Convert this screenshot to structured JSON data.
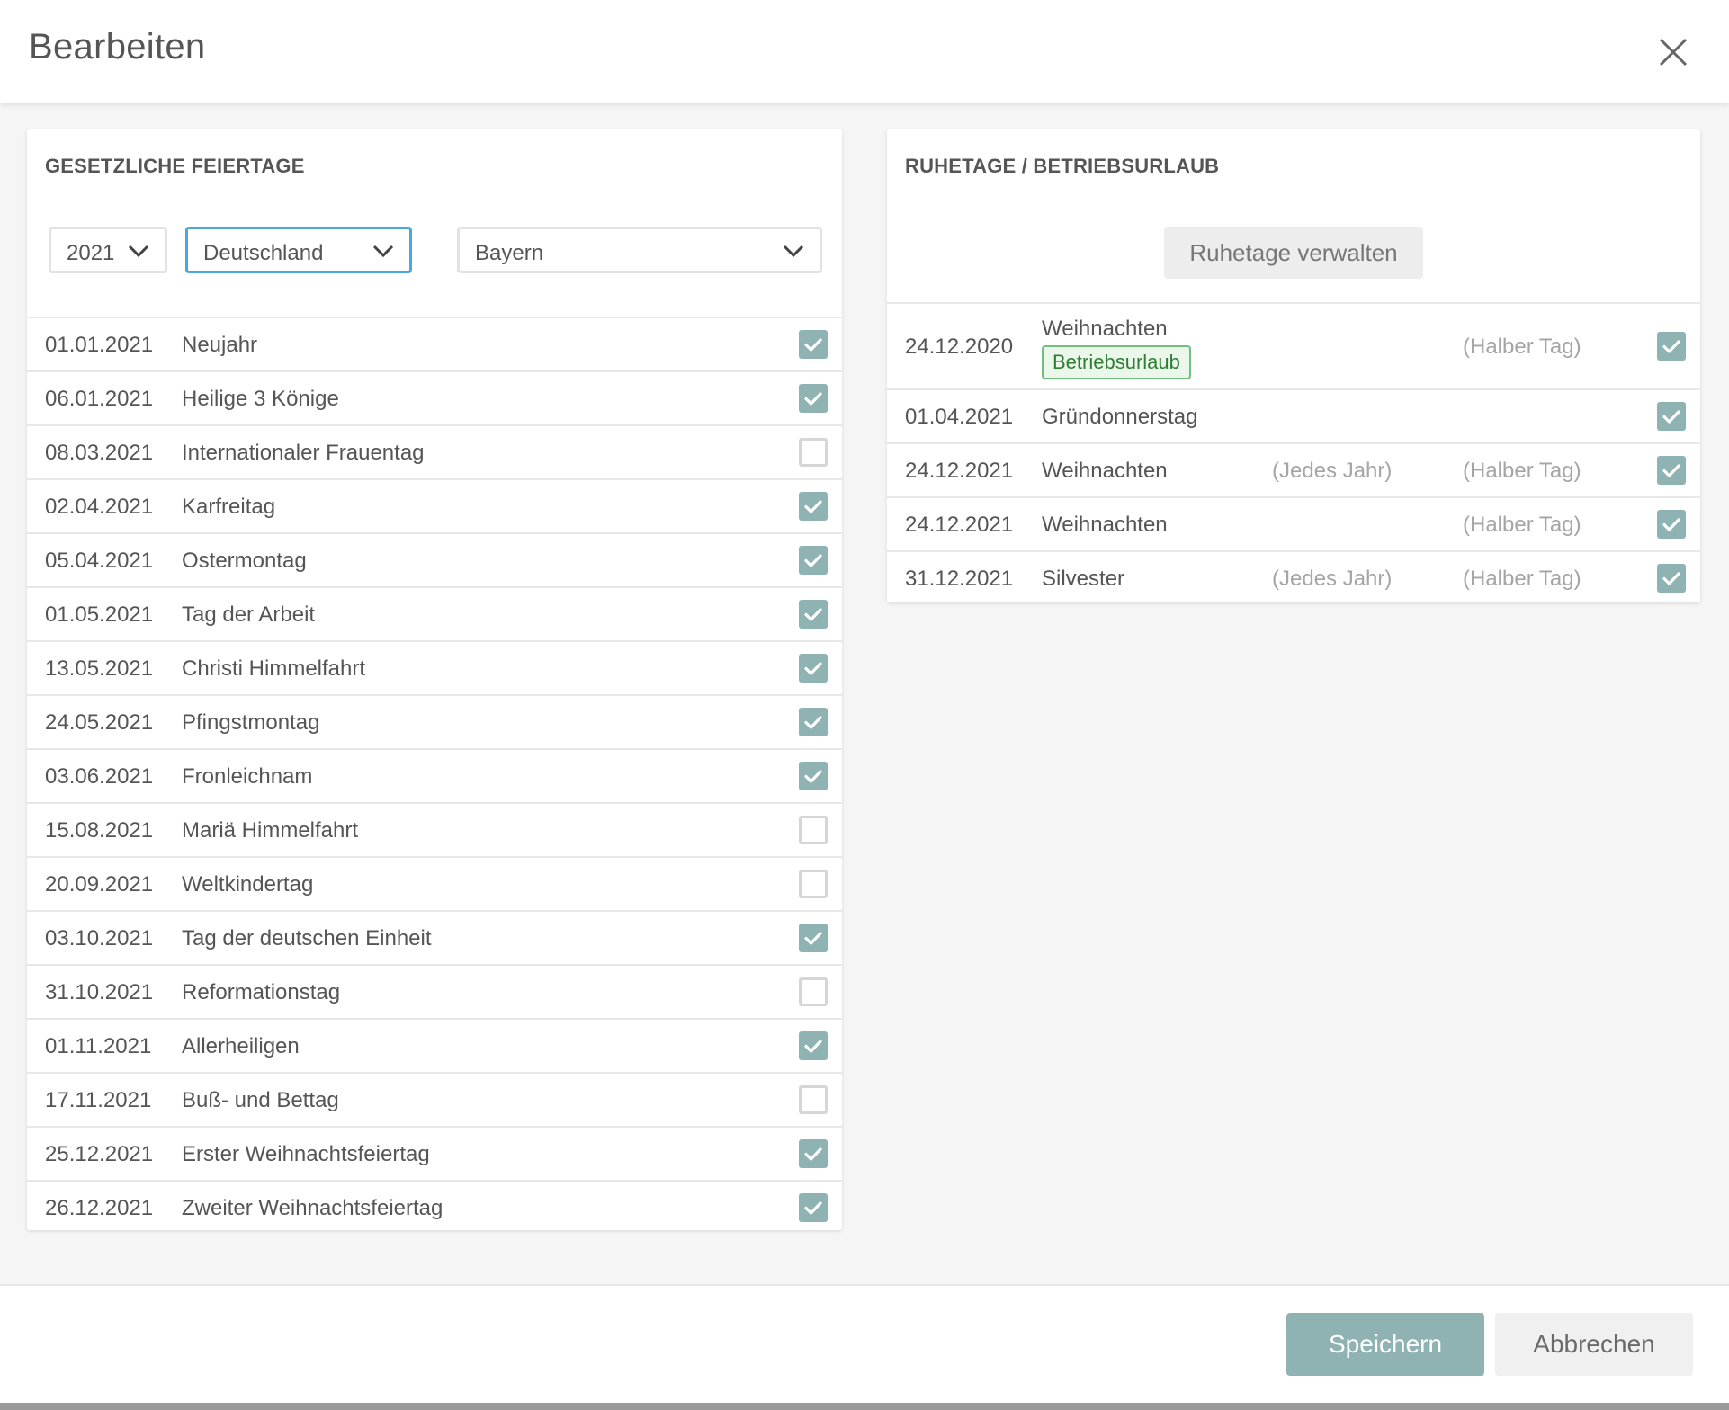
{
  "dialog": {
    "title": "Bearbeiten",
    "close_icon": "close-icon"
  },
  "left_card": {
    "title": "GESETZLICHE FEIERTAGE",
    "year_select": {
      "value": "2021"
    },
    "country_select": {
      "value": "Deutschland"
    },
    "state_select": {
      "value": "Bayern"
    },
    "holidays": [
      {
        "date": "01.01.2021",
        "name": "Neujahr",
        "checked": true
      },
      {
        "date": "06.01.2021",
        "name": "Heilige 3 Könige",
        "checked": true
      },
      {
        "date": "08.03.2021",
        "name": "Internationaler Frauentag",
        "checked": false
      },
      {
        "date": "02.04.2021",
        "name": "Karfreitag",
        "checked": true
      },
      {
        "date": "05.04.2021",
        "name": "Ostermontag",
        "checked": true
      },
      {
        "date": "01.05.2021",
        "name": "Tag der Arbeit",
        "checked": true
      },
      {
        "date": "13.05.2021",
        "name": "Christi Himmelfahrt",
        "checked": true
      },
      {
        "date": "24.05.2021",
        "name": "Pfingstmontag",
        "checked": true
      },
      {
        "date": "03.06.2021",
        "name": "Fronleichnam",
        "checked": true
      },
      {
        "date": "15.08.2021",
        "name": "Mariä Himmelfahrt",
        "checked": false
      },
      {
        "date": "20.09.2021",
        "name": "Weltkindertag",
        "checked": false
      },
      {
        "date": "03.10.2021",
        "name": "Tag der deutschen Einheit",
        "checked": true
      },
      {
        "date": "31.10.2021",
        "name": "Reformationstag",
        "checked": false
      },
      {
        "date": "01.11.2021",
        "name": "Allerheiligen",
        "checked": true
      },
      {
        "date": "17.11.2021",
        "name": "Buß- und Bettag",
        "checked": false
      },
      {
        "date": "25.12.2021",
        "name": "Erster Weihnachtsfeiertag",
        "checked": true
      },
      {
        "date": "26.12.2021",
        "name": "Zweiter Weihnachtsfeiertag",
        "checked": true
      }
    ]
  },
  "right_card": {
    "title": "RUHETAGE / BETRIEBSURLAUB",
    "manage_button": "Ruhetage verwalten",
    "rest_days": [
      {
        "date": "24.12.2020",
        "name": "Weihnachten",
        "badge": "Betriebsurlaub",
        "every_year": "",
        "half_day": "(Halber Tag)",
        "checked": true
      },
      {
        "date": "01.04.2021",
        "name": "Gründonnerstag",
        "badge": "",
        "every_year": "",
        "half_day": "",
        "checked": true
      },
      {
        "date": "24.12.2021",
        "name": "Weihnachten",
        "badge": "",
        "every_year": "(Jedes Jahr)",
        "half_day": "(Halber Tag)",
        "checked": true
      },
      {
        "date": "24.12.2021",
        "name": "Weihnachten",
        "badge": "",
        "every_year": "",
        "half_day": "(Halber Tag)",
        "checked": true
      },
      {
        "date": "31.12.2021",
        "name": "Silvester",
        "badge": "",
        "every_year": "(Jedes Jahr)",
        "half_day": "(Halber Tag)",
        "checked": true
      }
    ]
  },
  "footer": {
    "save_label": "Speichern",
    "cancel_label": "Abbrechen"
  },
  "colors": {
    "accent": "#8fb3b3",
    "focus_border": "#4aa8e0",
    "badge_border": "#6fbf7f",
    "badge_text": "#2e7d32"
  }
}
